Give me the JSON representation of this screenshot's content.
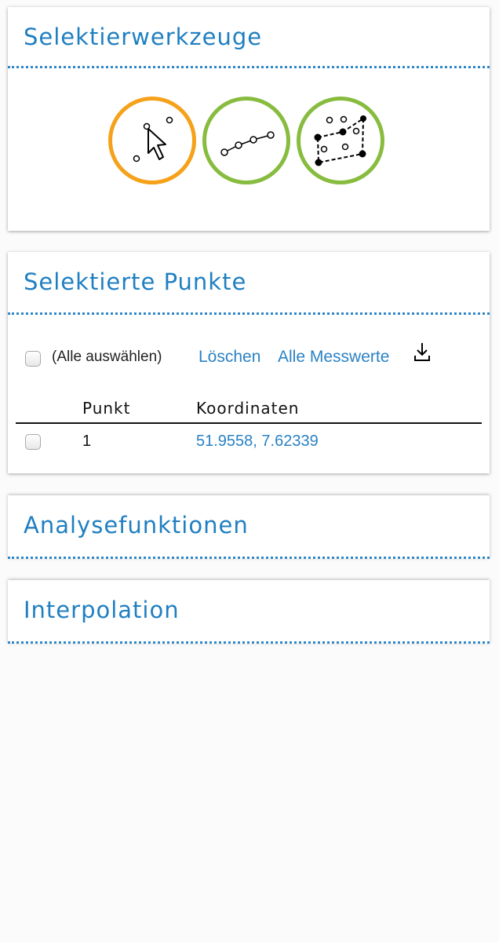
{
  "selektierwerkzeuge": {
    "title": "Selektierwerkzeuge",
    "tools": [
      {
        "icon": "point-select-icon",
        "color": "#f5a11a",
        "active": true
      },
      {
        "icon": "line-select-icon",
        "color": "#87bc3f",
        "active": false
      },
      {
        "icon": "polygon-select-icon",
        "color": "#87bc3f",
        "active": false
      }
    ]
  },
  "selektierte_punkte": {
    "title": "Selektierte Punkte",
    "select_all_label": "(Alle auswählen)",
    "delete_link": "Löschen",
    "all_values_link": "Alle Messwerte",
    "download_icon": "download-icon",
    "columns": [
      "Punkt",
      "Koordinaten"
    ],
    "rows": [
      {
        "punkt": "1",
        "koordinaten": "51.9558, 7.62339"
      }
    ]
  },
  "analysefunktionen": {
    "title": "Analysefunktionen"
  },
  "interpolation": {
    "title": "Interpolation"
  },
  "colors": {
    "accent": "#1f7fc1",
    "link": "#2a82c4",
    "orange": "#f5a11a",
    "green": "#87bc3f"
  }
}
